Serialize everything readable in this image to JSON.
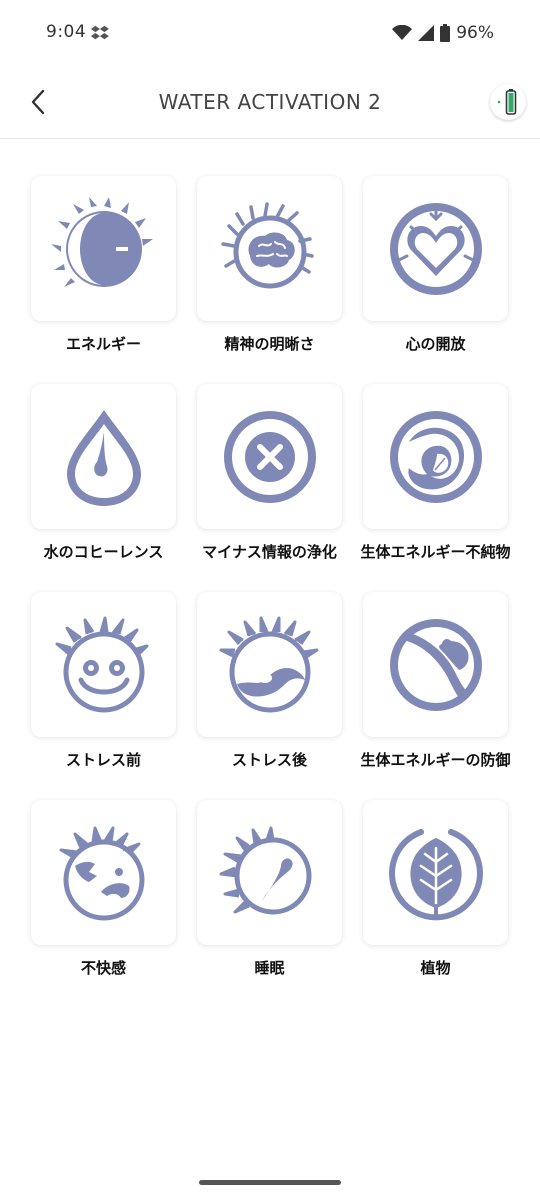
{
  "status": {
    "time": "9:04",
    "battery": "96%"
  },
  "header": {
    "title": "WATER ACTIVATION 2"
  },
  "colors": {
    "icon": "#8089b6",
    "battery_green": "#33a86b"
  },
  "items": [
    {
      "label": "エネルギー",
      "icon": "energy-icon"
    },
    {
      "label": "精神の明晰さ",
      "icon": "brain-icon"
    },
    {
      "label": "心の開放",
      "icon": "heart-icon"
    },
    {
      "label": "水のコヒーレンス",
      "icon": "water-drop-icon"
    },
    {
      "label": "マイナス情報の浄化",
      "icon": "cross-icon"
    },
    {
      "label": "生体エネルギー不純物",
      "icon": "bio-leaf-icon"
    },
    {
      "label": "ストレス前",
      "icon": "face-happy-icon"
    },
    {
      "label": "ストレス後",
      "icon": "face-stressed-icon"
    },
    {
      "label": "生体エネルギーの防御",
      "icon": "protection-icon"
    },
    {
      "label": "不快感",
      "icon": "face-discomfort-icon"
    },
    {
      "label": "睡眠",
      "icon": "sleep-icon"
    },
    {
      "label": "植物",
      "icon": "plant-icon"
    }
  ]
}
